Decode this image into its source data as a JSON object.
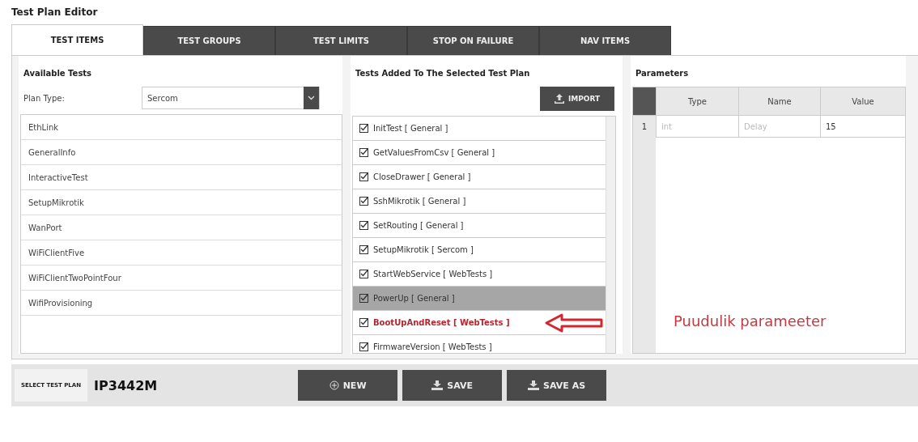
{
  "window": {
    "title": "Test Plan Editor"
  },
  "tabs": [
    {
      "label": "TEST ITEMS",
      "selected": true
    },
    {
      "label": "TEST GROUPS",
      "selected": false
    },
    {
      "label": "TEST LIMITS",
      "selected": false
    },
    {
      "label": "STOP ON FAILURE",
      "selected": false
    },
    {
      "label": "NAV ITEMS",
      "selected": false
    }
  ],
  "available_tests": {
    "title": "Available Tests",
    "plan_type_label": "Plan Type:",
    "plan_type_value": "Sercom",
    "items": [
      "EthLink",
      "GeneralInfo",
      "InteractiveTest",
      "SetupMikrotik",
      "WanPort",
      "WiFiClientFive",
      "WiFiClientTwoPointFour",
      "WifiProvisioning"
    ]
  },
  "added_tests": {
    "title": "Tests Added To The Selected Test Plan",
    "import_button": "IMPORT",
    "items": [
      {
        "label": "InitTest [ General ]",
        "checked": true,
        "selected": false,
        "missing": false
      },
      {
        "label": "GetValuesFromCsv [ General ]",
        "checked": true,
        "selected": false,
        "missing": false
      },
      {
        "label": "CloseDrawer [ General ]",
        "checked": true,
        "selected": false,
        "missing": false
      },
      {
        "label": "SshMikrotik [ General ]",
        "checked": true,
        "selected": false,
        "missing": false
      },
      {
        "label": "SetRouting [ General ]",
        "checked": true,
        "selected": false,
        "missing": false
      },
      {
        "label": "SetupMikrotik [ Sercom ]",
        "checked": true,
        "selected": false,
        "missing": false
      },
      {
        "label": "StartWebService [ WebTests ]",
        "checked": true,
        "selected": false,
        "missing": false
      },
      {
        "label": "PowerUp [ General ]",
        "checked": true,
        "selected": true,
        "missing": false
      },
      {
        "label": "BootUpAndReset [ WebTests ]",
        "checked": true,
        "selected": false,
        "missing": true
      },
      {
        "label": "FirmwareVersion [ WebTests ]",
        "checked": true,
        "selected": false,
        "missing": false
      }
    ]
  },
  "parameters": {
    "title": "Parameters",
    "columns": [
      "Type",
      "Name",
      "Value"
    ],
    "rows": [
      {
        "index": "1",
        "cells": [
          {
            "text": "int",
            "disabled": true
          },
          {
            "text": "Delay",
            "disabled": true
          },
          {
            "text": "15",
            "disabled": false
          }
        ]
      }
    ]
  },
  "annotation": {
    "text": "Puudulik parameeter"
  },
  "footer": {
    "select_label": "SELECT TEST PLAN",
    "plan_name": "IP3442M",
    "buttons": [
      {
        "label": "NEW",
        "kind": "new"
      },
      {
        "label": "SAVE",
        "kind": "save"
      },
      {
        "label": "SAVE AS",
        "kind": "save"
      }
    ]
  }
}
